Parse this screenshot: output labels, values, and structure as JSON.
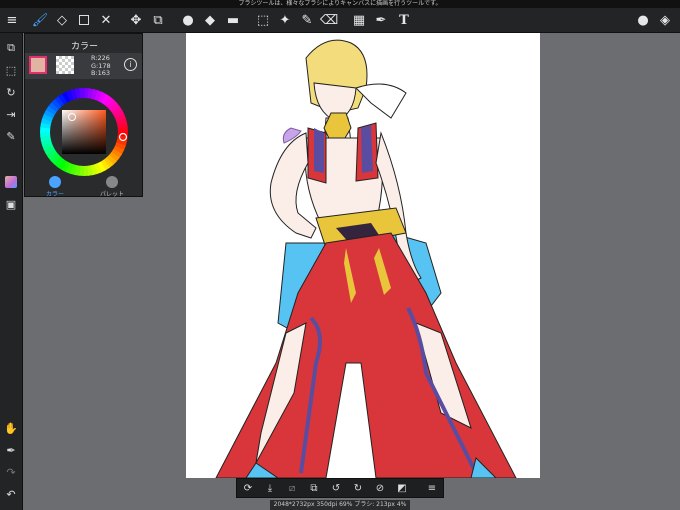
{
  "status_bar": {
    "hint": "ブラシツールは、様々なブラシによりキャンバスに描画を行うツールです。"
  },
  "color_panel": {
    "title": "カラー",
    "main_color": "#E2B2A3",
    "rgb": {
      "r": "R:226",
      "g": "G:178",
      "b": "B:163"
    },
    "info_label": "i",
    "tabs": [
      {
        "label": "カラー"
      },
      {
        "label": "パレット"
      }
    ]
  },
  "toolbar": {
    "text_tool_label": "T",
    "menu_icon": "menu-icon"
  },
  "canvas_status": {
    "text": "2048*2732px 350dpi 69% ブラシ: 213px 4%"
  },
  "colors": {
    "accent": "#4AA3FF",
    "panel_bg": "#2A2B2D",
    "toolbar_bg": "#232426",
    "canvas_bg": "#6B6D70"
  }
}
